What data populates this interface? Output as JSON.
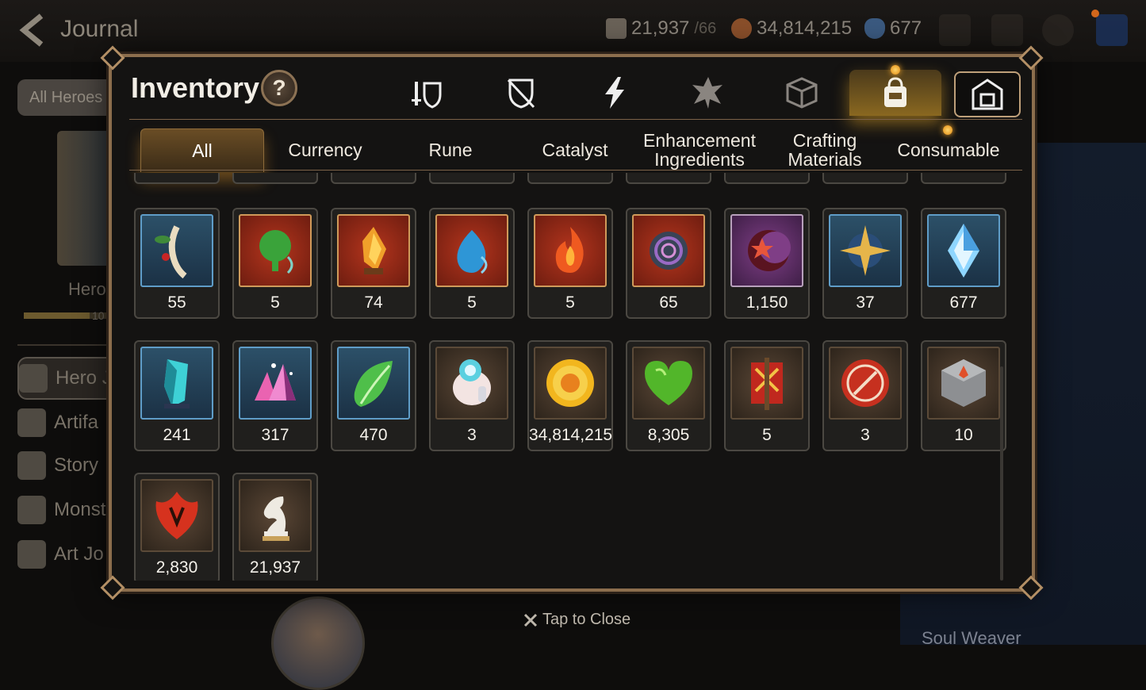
{
  "header": {
    "title": "Journal",
    "resources": [
      {
        "name": "skystone-leaf",
        "value": "21,937",
        "cap": "/66"
      },
      {
        "name": "gold",
        "value": "34,814,215"
      },
      {
        "name": "crystal",
        "value": "677"
      }
    ]
  },
  "background": {
    "filter_label": "All Heroes",
    "hero_label": "Hero",
    "bar_num": "10",
    "nav": [
      "Hero J",
      "Artifa",
      "Story",
      "Monst",
      "Art Jo"
    ],
    "right_label": "Soul Weaver"
  },
  "modal": {
    "title": "Inventory",
    "help": "?",
    "category_tabs": [
      "equipment-icon",
      "shield-icon",
      "artifact-icon",
      "material-icon",
      "cube-icon",
      "bag-icon",
      "storage-icon"
    ],
    "sub_tabs": [
      {
        "label": "All"
      },
      {
        "label": "Currency"
      },
      {
        "label": "Rune"
      },
      {
        "label": "Catalyst"
      },
      {
        "label": "Enhancement Ingredients"
      },
      {
        "label": "Crafting Materials"
      },
      {
        "label": "Consumable"
      }
    ],
    "items": [
      {
        "icon": "ginseng-icon",
        "frame": "blue",
        "qty": "55"
      },
      {
        "icon": "tree-rune-icon",
        "frame": "red",
        "qty": "5"
      },
      {
        "icon": "flame-crystal-icon",
        "frame": "red",
        "qty": "74"
      },
      {
        "icon": "water-rune-icon",
        "frame": "red",
        "qty": "5"
      },
      {
        "icon": "fire-rune-icon",
        "frame": "red",
        "qty": "5"
      },
      {
        "icon": "swirl-rune-icon",
        "frame": "red",
        "qty": "65"
      },
      {
        "icon": "moon-rune-icon",
        "frame": "purple",
        "qty": "1,150"
      },
      {
        "icon": "star-rune-icon",
        "frame": "blue",
        "qty": "37"
      },
      {
        "icon": "crystal-gem-icon",
        "frame": "blue",
        "qty": "677"
      },
      {
        "icon": "cyan-crystal-icon",
        "frame": "blue",
        "qty": "241"
      },
      {
        "icon": "pink-crystals-icon",
        "frame": "blue",
        "qty": "317"
      },
      {
        "icon": "green-leaf-icon",
        "frame": "blue",
        "qty": "470"
      },
      {
        "icon": "pet-pouch-icon",
        "frame": "brown",
        "qty": "3"
      },
      {
        "icon": "gold-coin-icon",
        "frame": "brown",
        "qty": "34,814,215"
      },
      {
        "icon": "green-heart-icon",
        "frame": "brown",
        "qty": "8,305"
      },
      {
        "icon": "war-banner-icon",
        "frame": "brown",
        "qty": "5"
      },
      {
        "icon": "seal-badge-icon",
        "frame": "brown",
        "qty": "3"
      },
      {
        "icon": "stone-cube-icon",
        "frame": "brown",
        "qty": "10"
      },
      {
        "icon": "red-leaf-icon",
        "frame": "brown",
        "qty": "2,830"
      },
      {
        "icon": "chess-knight-icon",
        "frame": "brown",
        "qty": "21,937"
      }
    ]
  },
  "close_hint": "Tap to Close",
  "colors": {
    "accent": "#e8a93a",
    "modal_border": "#8c6e4d"
  }
}
